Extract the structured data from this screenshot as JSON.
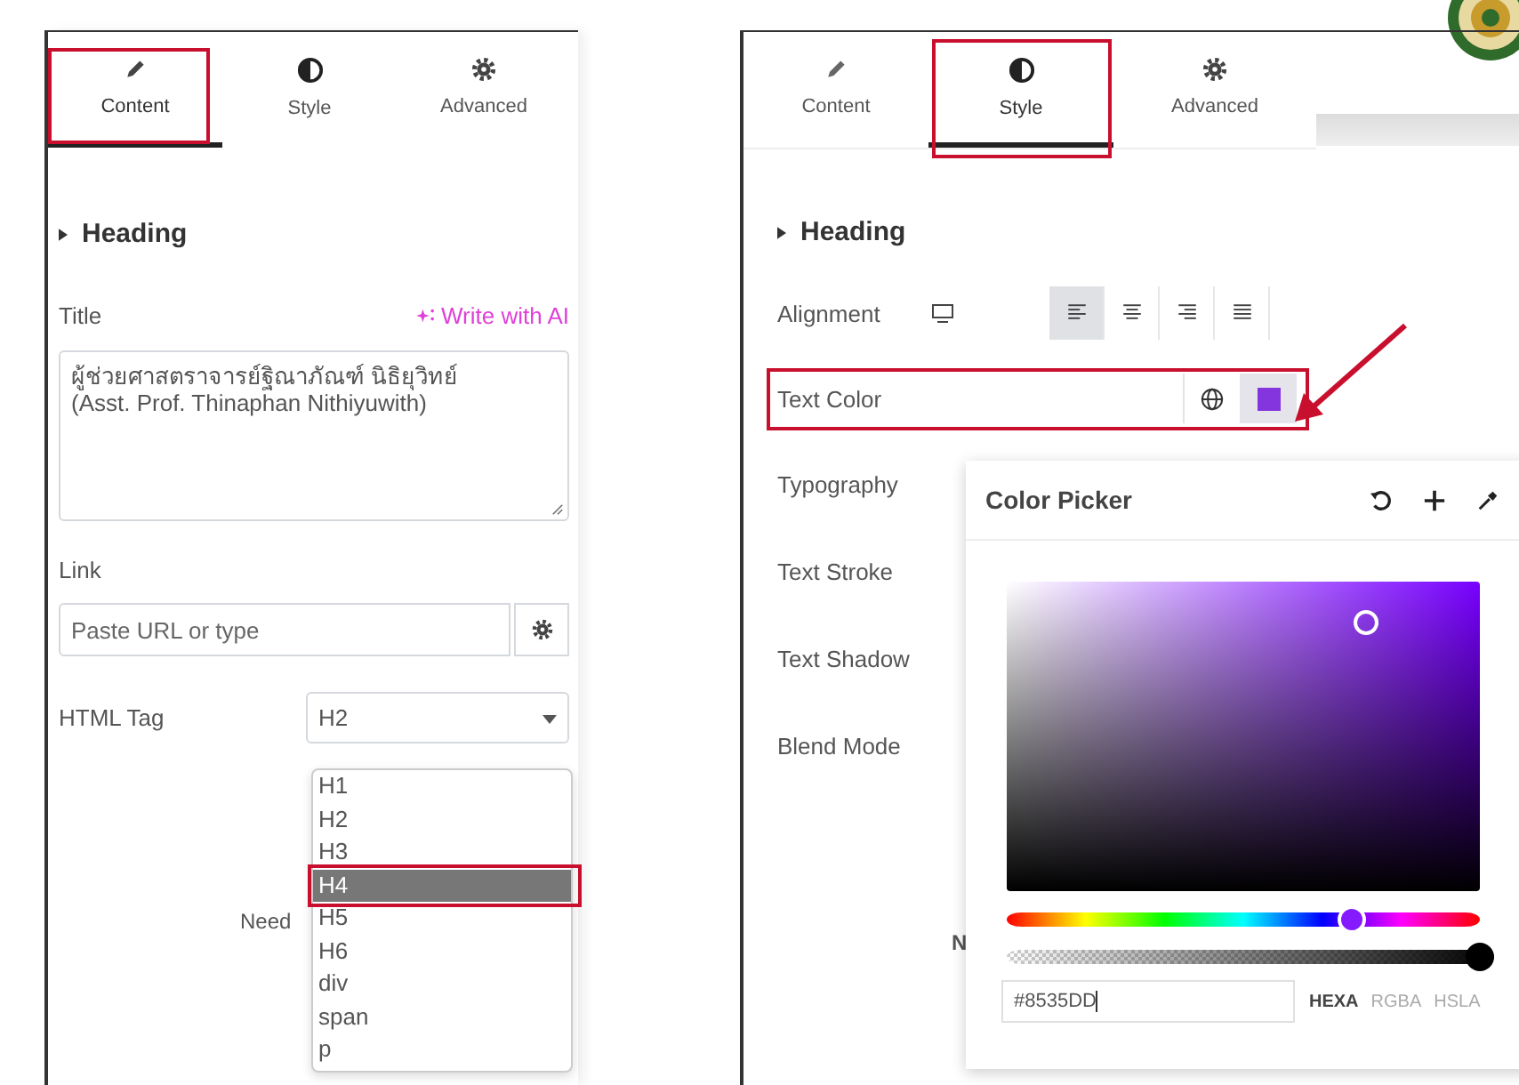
{
  "content_panel": {
    "tabs": [
      {
        "label": "Content",
        "kind": "pencil",
        "selected": true
      },
      {
        "label": "Style",
        "kind": "contrast",
        "selected": false
      },
      {
        "label": "Advanced",
        "kind": "gear",
        "selected": false
      }
    ],
    "section": "Heading",
    "title": {
      "label": "Title",
      "ai_action": "Write with AI",
      "value": "ผู้ช่วยศาสตราจารย์ฐิณาภัณฑ์ นิธิยุวิทย์\n(Asst. Prof. Thinaphan Nithiyuwith)"
    },
    "link": {
      "label": "Link",
      "placeholder": "Paste URL or type"
    },
    "html_tag": {
      "label": "HTML Tag",
      "value": "H2",
      "options": [
        {
          "label": "H1",
          "highlighted": false
        },
        {
          "label": "H2",
          "highlighted": false
        },
        {
          "label": "H3",
          "highlighted": false
        },
        {
          "label": "H4",
          "highlighted": true
        },
        {
          "label": "H5",
          "highlighted": false
        },
        {
          "label": "H6",
          "highlighted": false
        },
        {
          "label": "div",
          "highlighted": false
        },
        {
          "label": "span",
          "highlighted": false
        },
        {
          "label": "p",
          "highlighted": false
        }
      ]
    },
    "covered_text": "Need"
  },
  "style_panel": {
    "tabs": [
      {
        "label": "Content",
        "kind": "pencil",
        "selected": false
      },
      {
        "label": "Style",
        "kind": "contrast",
        "selected": true
      },
      {
        "label": "Advanced",
        "kind": "gear",
        "selected": false
      }
    ],
    "section": "Heading",
    "alignment": {
      "label": "Alignment",
      "options": [
        {
          "kind": "left",
          "selected": true
        },
        {
          "kind": "center",
          "selected": false
        },
        {
          "kind": "right",
          "selected": false
        },
        {
          "kind": "justify",
          "selected": false
        }
      ]
    },
    "text_color": {
      "label": "Text Color"
    },
    "controls": [
      "Typography",
      "Text Stroke",
      "Text Shadow",
      "Blend Mode"
    ],
    "covered_text": "N",
    "color_picker": {
      "title": "Color Picker",
      "hue": {
        "level": 0.745
      },
      "alpha": {
        "level": 1
      },
      "value": "#8535DD",
      "formats": [
        {
          "label": "HEXA",
          "selected": true
        },
        {
          "label": "RGBA",
          "selected": false
        },
        {
          "label": "HSLA",
          "selected": false
        }
      ]
    }
  }
}
